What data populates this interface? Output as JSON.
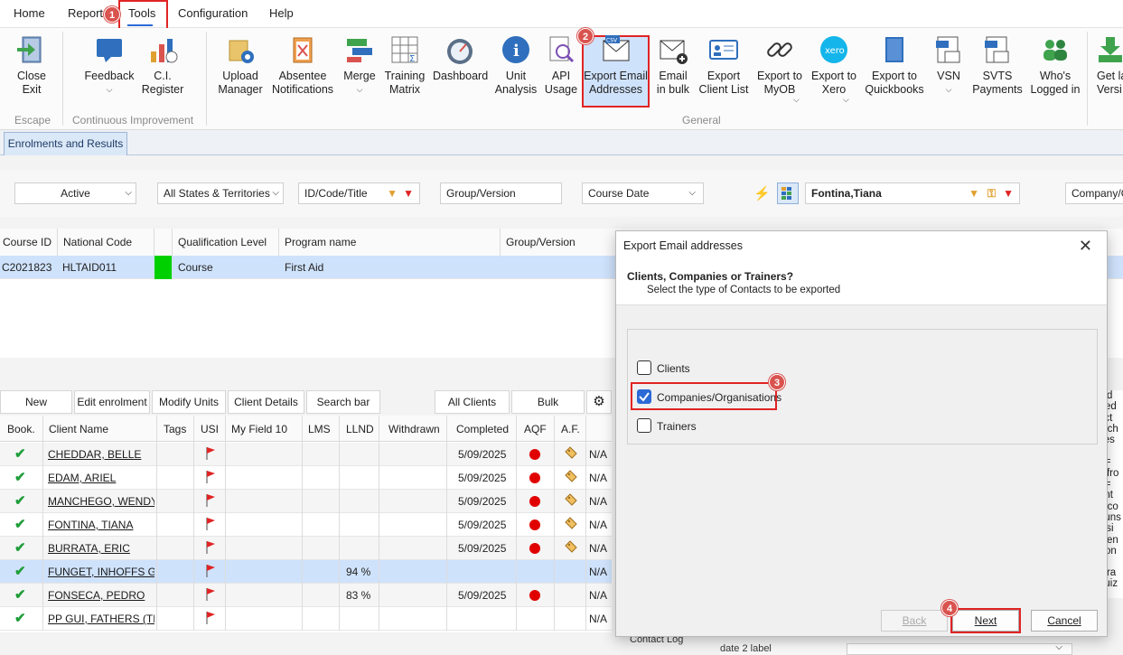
{
  "menu": {
    "items": [
      "Home",
      "Reports",
      "Tools",
      "Configuration",
      "Help"
    ]
  },
  "ribbon": {
    "close_exit": "Close\nExit",
    "feedback": "Feedback",
    "ci_register": "C.I.\nRegister",
    "upload_manager": "Upload\nManager",
    "absentee": "Absentee\nNotifications",
    "merge": "Merge",
    "training_matrix": "Training\nMatrix",
    "dashboard": "Dashboard",
    "unit_analysis": "Unit\nAnalysis",
    "api_usage": "API\nUsage",
    "export_email": "Export Email\nAddresses",
    "email_bulk": "Email\nin bulk",
    "export_client_list": "Export\nClient List",
    "export_myob": "Export to\nMyOB",
    "export_xero": "Export to\nXero",
    "export_qb": "Export to\nQuickbooks",
    "vsn": "VSN",
    "svts": "SVTS\nPayments",
    "whos_logged": "Who's\nLogged in",
    "get_latest": "Get la\nVersi",
    "group_escape": "Escape",
    "group_ci": "Continuous Improvement",
    "group_general": "General",
    "xero_logo": "xero",
    "csv_badge": "CSV"
  },
  "tabs": {
    "enrolments": "Enrolments and Results"
  },
  "filters": {
    "status": "Active",
    "states": "All States & Territories",
    "id_code": "ID/Code/Title",
    "group_version": "Group/Version",
    "course_date": "Course Date",
    "trainer": "Fontina,Tiana",
    "company": "Company/O"
  },
  "course_grid": {
    "headers": [
      "Course ID",
      "National Code",
      "",
      "Qualification Level",
      "Program name",
      "Group/Version"
    ],
    "rows": [
      {
        "course_id": "C2021823",
        "national_code": "HLTAID011",
        "level": "Course",
        "program": "First Aid",
        "group": ""
      }
    ]
  },
  "enrol_toolbar": {
    "new_enrolment": "New Enrolment",
    "edit_enrolment": "Edit enrolment",
    "modify_units": "Modify Units",
    "client_details": "Client Details",
    "search_bar": "Search bar",
    "all_clients": "All Clients",
    "bulk": "Bulk"
  },
  "enrol_grid": {
    "headers": [
      "Book.",
      "Client Name",
      "Tags",
      "USI",
      "My Field 10",
      "LMS",
      "LLND",
      "Withdrawn",
      "Completed",
      "AQF",
      "A.F.",
      ""
    ],
    "rows": [
      {
        "name": "CHEDDAR, BELLE",
        "llnd": "",
        "completed": "5/09/2025",
        "aqf": true,
        "af": true,
        "na": "N/A",
        "selected": false
      },
      {
        "name": "EDAM, ARIEL",
        "llnd": "",
        "completed": "5/09/2025",
        "aqf": true,
        "af": true,
        "na": "N/A",
        "selected": false
      },
      {
        "name": "MANCHEGO, WENDY",
        "llnd": "",
        "completed": "5/09/2025",
        "aqf": true,
        "af": true,
        "na": "N/A",
        "selected": false
      },
      {
        "name": "FONTINA, TIANA",
        "llnd": "",
        "completed": "5/09/2025",
        "aqf": true,
        "af": true,
        "na": "N/A",
        "selected": false
      },
      {
        "name": "BURRATA, ERIC",
        "llnd": "",
        "completed": "5/09/2025",
        "aqf": true,
        "af": true,
        "na": "N/A",
        "selected": false
      },
      {
        "name": "FUNGET, INHOFFS GRE",
        "llnd": "94 %",
        "completed": "",
        "aqf": false,
        "af": false,
        "na": "N/A",
        "selected": true
      },
      {
        "name": "FONSECA, PEDRO",
        "llnd": "83 %",
        "completed": "5/09/2025",
        "aqf": true,
        "af": false,
        "na": "N/A",
        "selected": false
      },
      {
        "name": "PP GUI, FATHERS (TEST",
        "llnd": "",
        "completed": "",
        "aqf": false,
        "af": false,
        "na": "N/A",
        "selected": false
      }
    ]
  },
  "right_panel_text": [
    "led",
    "rted",
    "act",
    "atch",
    "Tes",
    "==",
    "s fro",
    "==",
    "ent",
    "e co",
    "ouns",
    "issi",
    "s en",
    "fron",
    "stra",
    "quiz"
  ],
  "bottom_partial": {
    "contact_log": "Contact Log",
    "date_label": "date 2 label"
  },
  "dialog": {
    "title": "Export Email addresses",
    "heading": "Clients, Companies or Trainers?",
    "subheading": "Select the type of Contacts to be exported",
    "options": [
      {
        "label": "Clients",
        "checked": false
      },
      {
        "label": "Companies/Organisations",
        "checked": true
      },
      {
        "label": "Trainers",
        "checked": false
      }
    ],
    "back": "Back",
    "next": "Next",
    "cancel": "Cancel"
  },
  "markers": [
    "1",
    "2",
    "3",
    "4"
  ],
  "colors": {
    "accent": "#2b6ad6",
    "highlight_row": "#cfe2fb",
    "marker_red": "#d9534f",
    "status_green": "#00d000"
  }
}
